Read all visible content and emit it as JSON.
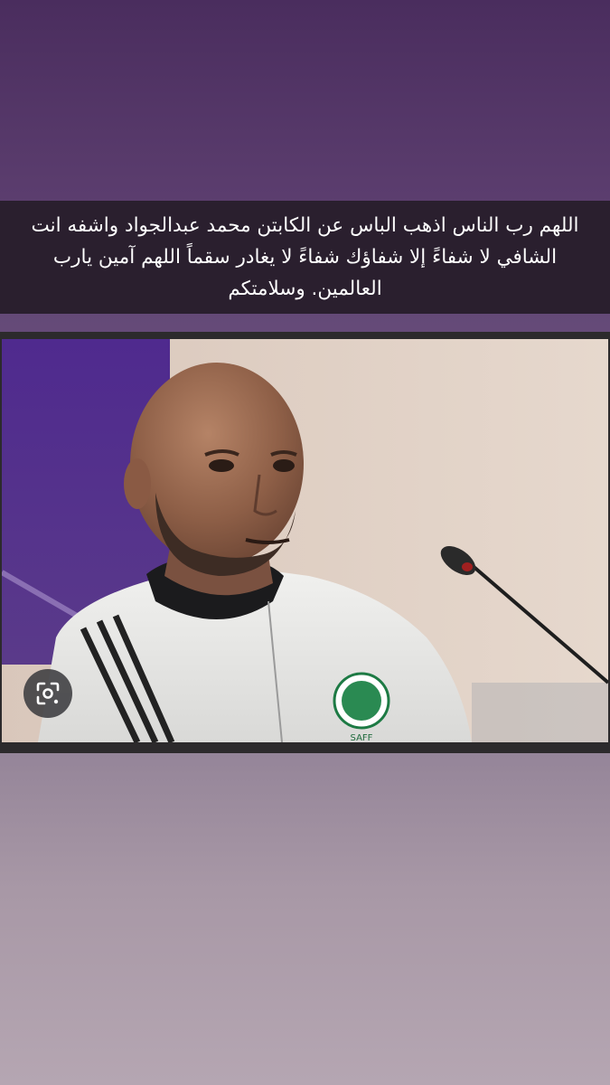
{
  "caption": {
    "line_1": "اللهم رب الناس اذهب الباس عن الكابتن محمد عبدالجواد واشفه انت",
    "line_2": "الشافي لا شفاءً إلا شفاؤك شفاءً لا يغادر سقماً اللهم آمين يارب",
    "line_3": "العالمين. وسلامتكم"
  },
  "photo": {
    "badge_text": "SAFF"
  },
  "lens_button": {
    "icon": "visual-search-icon"
  },
  "colors": {
    "caption_background": "#2a1f2e",
    "caption_text": "#ffffff",
    "page_gradient_top": "#4a2d5e",
    "page_gradient_bottom": "#b5a6b2"
  }
}
